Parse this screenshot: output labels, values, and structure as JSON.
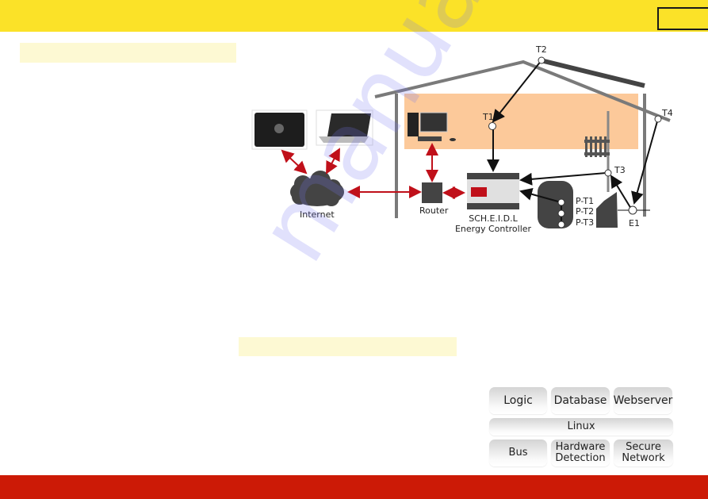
{
  "header": {
    "page_number": ""
  },
  "section_headings": [
    "",
    ""
  ],
  "diagram": {
    "sensors": {
      "t1": "T1",
      "t2": "T2",
      "t3": "T3",
      "t4": "T4",
      "e1": "E1"
    },
    "tank_sensors": [
      "P-T1",
      "P-T2",
      "P-T3"
    ],
    "internet_label": "Internet",
    "router_label": "Router",
    "controller_label_line1": "SCH.E.I.D.L",
    "controller_label_line2": "Energy Controller",
    "devices": [
      "tablet",
      "laptop",
      "desktop-pc"
    ],
    "colors": {
      "house_interior": "#fcc99a",
      "link_arrow": "#c0101a",
      "device_dark": "#444444",
      "controller_accent": "#c0101a"
    }
  },
  "software_stack": {
    "top_row": [
      "Logic",
      "Database",
      "Webserver"
    ],
    "middle": "Linux",
    "bottom_row": [
      {
        "line1": "Bus",
        "line2": ""
      },
      {
        "line1": "Hardware",
        "line2": "Detection"
      },
      {
        "line1": "Secure",
        "line2": "Network"
      }
    ]
  },
  "watermark": "manualshive.com",
  "colors": {
    "top_bar": "#fbe228",
    "bottom_bar": "#cc1a06",
    "heading_band": "#fdf9d3"
  }
}
